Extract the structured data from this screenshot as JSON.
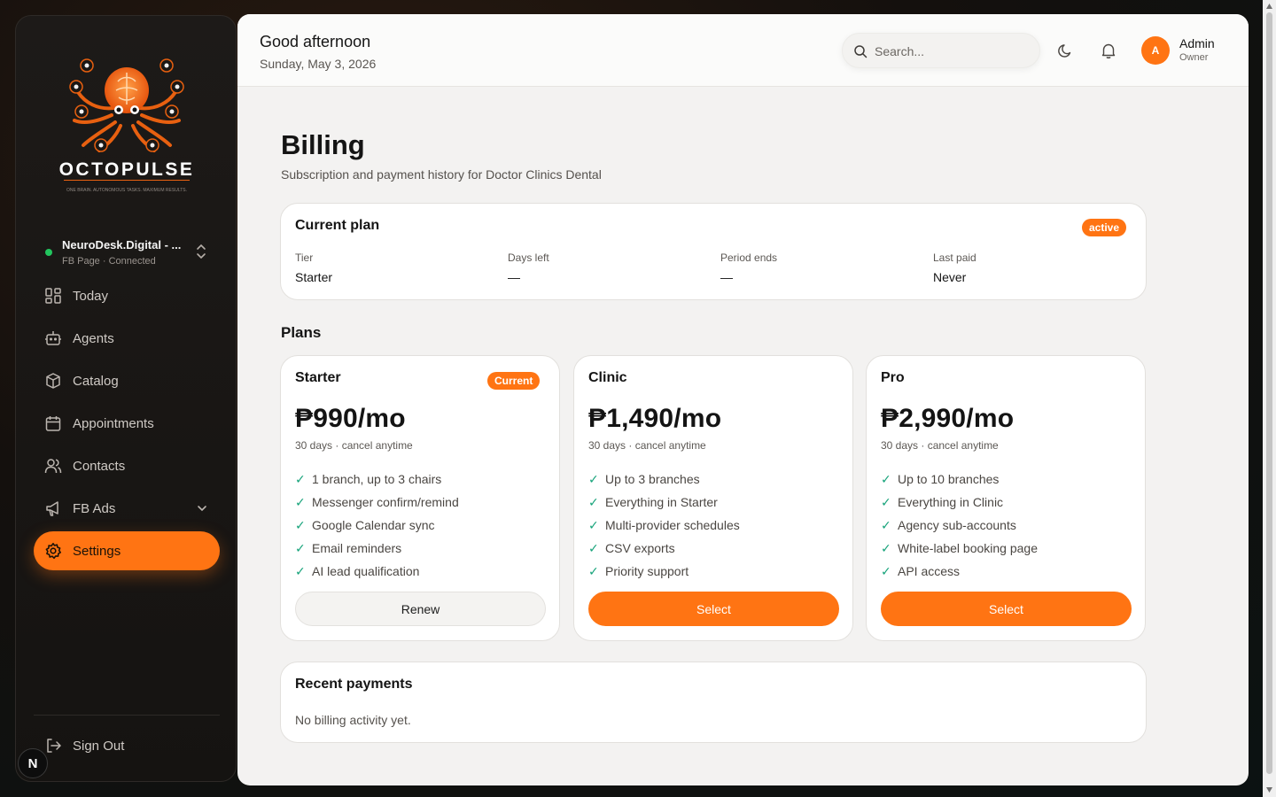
{
  "sidebar": {
    "brand": {
      "logo_text": "OCTOPULSE",
      "logo_tagline": "ONE BRAIN. AUTONOMOUS TASKS. MAXIMUM RESULTS.",
      "workspace_name": "NeuroDesk.Digital - ...",
      "workspace_status": "FB Page · Connected"
    },
    "nav": [
      {
        "label": "Today",
        "icon": "grid-icon"
      },
      {
        "label": "Agents",
        "icon": "robot-icon"
      },
      {
        "label": "Catalog",
        "icon": "box-icon"
      },
      {
        "label": "Appointments",
        "icon": "calendar-icon"
      },
      {
        "label": "Contacts",
        "icon": "users-icon"
      },
      {
        "label": "FB Ads",
        "icon": "megaphone-icon"
      },
      {
        "label": "Settings",
        "icon": "gear-icon",
        "active": true
      }
    ],
    "sign_out": "Sign Out",
    "badge": "N"
  },
  "header": {
    "greeting": "Good afternoon",
    "date": "Sunday, May 3, 2026",
    "search_placeholder": "Search...",
    "user": {
      "initial": "A",
      "name": "Admin",
      "role": "Owner"
    }
  },
  "page": {
    "title": "Billing",
    "subtitle": "Subscription and payment history for Doctor Clinics Dental"
  },
  "current_plan": {
    "title": "Current plan",
    "status": "active",
    "stats": [
      {
        "label": "Tier",
        "value": "Starter"
      },
      {
        "label": "Days left",
        "value": "—"
      },
      {
        "label": "Period ends",
        "value": "—"
      },
      {
        "label": "Last paid",
        "value": "Never"
      }
    ]
  },
  "plans": {
    "heading": "Plans",
    "items": [
      {
        "name": "Starter",
        "badge": "Current",
        "price": "₱990/mo",
        "period": "30 days · cancel anytime",
        "features": [
          "1 branch, up to 3 chairs",
          "Messenger confirm/remind",
          "Google Calendar sync",
          "Email reminders",
          "AI lead qualification"
        ],
        "button": "Renew"
      },
      {
        "name": "Clinic",
        "price": "₱1,490/mo",
        "period": "30 days · cancel anytime",
        "features": [
          "Up to 3 branches",
          "Everything in Starter",
          "Multi-provider schedules",
          "CSV exports",
          "Priority support"
        ],
        "button": "Select"
      },
      {
        "name": "Pro",
        "price": "₱2,990/mo",
        "period": "30 days · cancel anytime",
        "features": [
          "Up to 10 branches",
          "Everything in Clinic",
          "Agency sub-accounts",
          "White-label booking page",
          "API access"
        ],
        "button": "Select"
      }
    ]
  },
  "payments": {
    "title": "Recent payments",
    "empty": "No billing activity yet."
  },
  "colors": {
    "accent": "#ff7413",
    "check": "#16a37a",
    "connected": "#22c55e"
  },
  "check_glyph": "✓"
}
